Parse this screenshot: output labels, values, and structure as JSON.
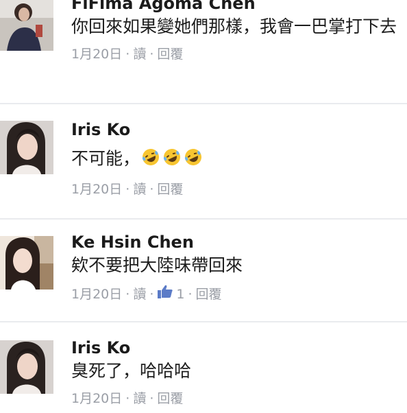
{
  "comments": [
    {
      "name": "FiFima Agoma Chen",
      "text": "你回來如果變她們那樣，我會一巴掌打下去",
      "date": "1月20日",
      "read": "讀",
      "reply": "回覆"
    },
    {
      "name": "Iris Ko",
      "text": "不可能，",
      "emojis": [
        "rolling-on-floor-laughing",
        "rolling-on-floor-laughing",
        "rolling-on-floor-laughing"
      ],
      "date": "1月20日",
      "read": "讀",
      "reply": "回覆"
    },
    {
      "name": "Ke Hsin Chen",
      "text": "欸不要把大陸味帶回來",
      "date": "1月20日",
      "read": "讀",
      "likes": "1",
      "reply": "回覆"
    },
    {
      "name": "Iris Ko",
      "text": "臭死了，哈哈哈",
      "date": "1月20日",
      "read": "讀",
      "reply": "回覆"
    }
  ],
  "separator": "·",
  "colors": {
    "name": "#1b1b1b",
    "meta": "#9a9ea6",
    "like": "#5b7bc7",
    "divider": "#e9ebee"
  }
}
